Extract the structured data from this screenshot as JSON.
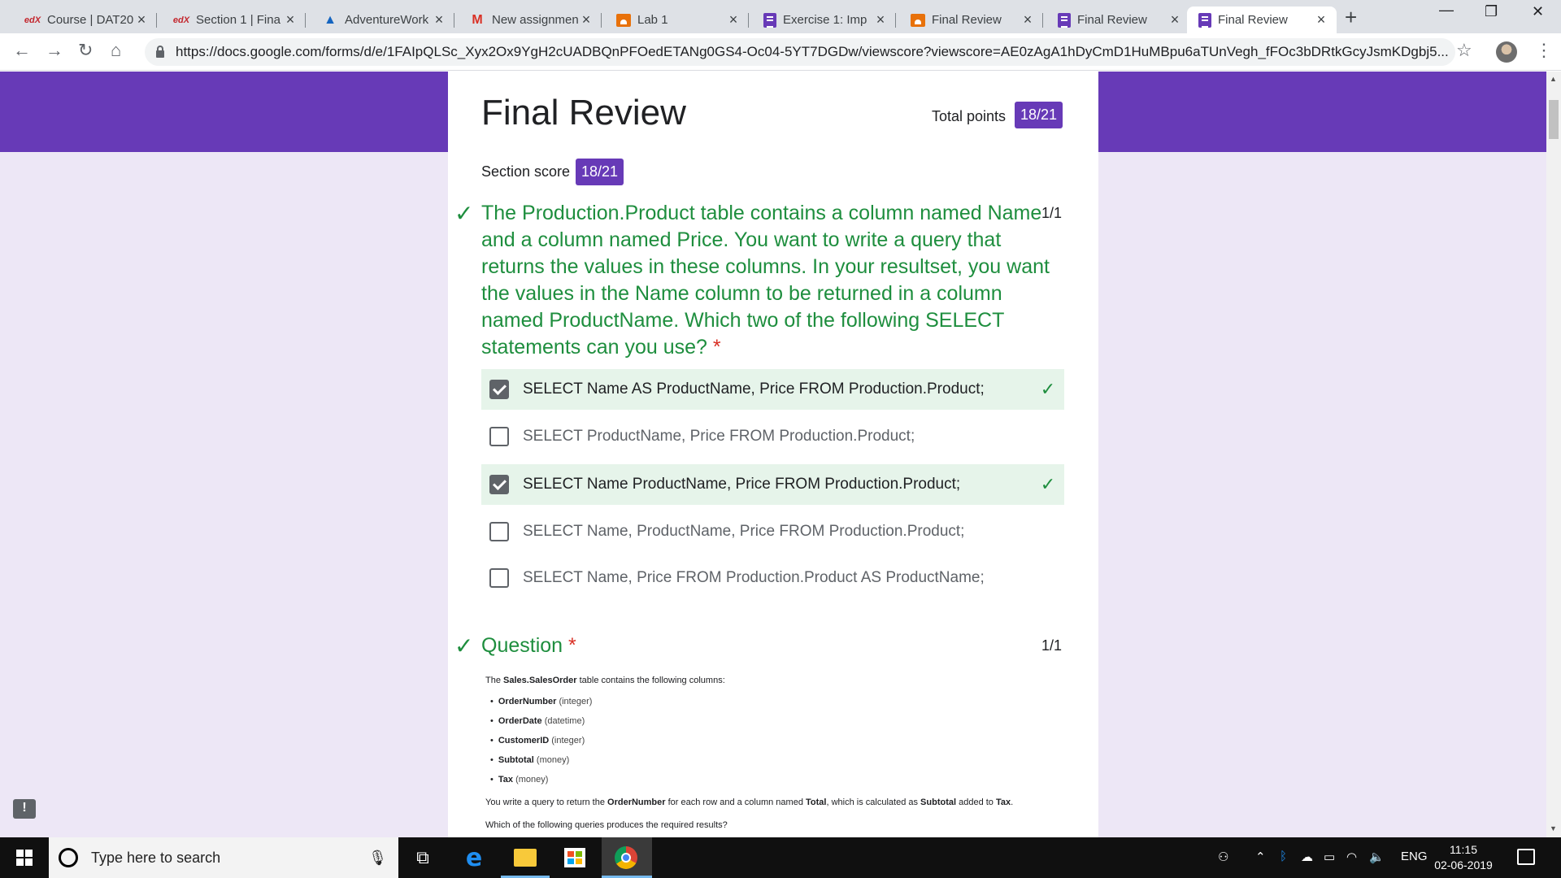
{
  "browser": {
    "tabs": [
      {
        "favicon": "edx-icon",
        "title": "Course | DAT20",
        "active": false
      },
      {
        "favicon": "edx-icon",
        "title": "Section 1 | Fina",
        "active": false
      },
      {
        "favicon": "azure-icon",
        "title": "AdventureWork",
        "active": false
      },
      {
        "favicon": "gmail-icon",
        "title": "New assignmen",
        "active": false
      },
      {
        "favicon": "classroom-icon",
        "title": "Lab 1",
        "active": false
      },
      {
        "favicon": "forms-icon",
        "title": "Exercise 1: Imp",
        "active": false
      },
      {
        "favicon": "classroom-icon",
        "title": "Final Review",
        "active": false
      },
      {
        "favicon": "forms-icon",
        "title": "Final Review",
        "active": false
      },
      {
        "favicon": "forms-icon",
        "title": "Final Review",
        "active": true
      }
    ],
    "url": "https://docs.google.com/forms/d/e/1FAIpQLSc_Xyx2Ox9YgH2cUADBQnPFOedETANg0GS4-Oc04-5YT7DGDw/viewscore?viewscore=AE0zAgA1hDyCmD1HuMBpu6aTUnVegh_fFOc3bDRtkGcyJsmKDgbj5..."
  },
  "form": {
    "title": "Final Review",
    "total_points_label": "Total points",
    "total_points": "18/21",
    "section_score_label": "Section score",
    "section_score": "18/21",
    "required_mark": "*",
    "q1": {
      "text": "The Production.Product table contains a column named Name and a column named Price. You want to write a query that returns the values in these columns. In your resultset, you want the values in the Name column to be returned in a column named ProductName. Which two of the following SELECT statements can you use?",
      "points": "1/1",
      "options": [
        {
          "label": "SELECT Name AS ProductName, Price FROM Production.Product;",
          "checked": true,
          "correct": true
        },
        {
          "label": "SELECT ProductName, Price FROM Production.Product;",
          "checked": false,
          "correct": false
        },
        {
          "label": "SELECT Name ProductName, Price FROM Production.Product;",
          "checked": true,
          "correct": true
        },
        {
          "label": "SELECT Name, ProductName, Price FROM Production.Product;",
          "checked": false,
          "correct": false
        },
        {
          "label": "SELECT Name, Price FROM Production.Product AS ProductName;",
          "checked": false,
          "correct": false
        }
      ]
    },
    "q2": {
      "title": "Question",
      "points": "1/1",
      "intro_pre": "The ",
      "intro_table": "Sales.SalesOrder",
      "intro_post": " table contains the following columns:",
      "columns": [
        {
          "name": "OrderNumber",
          "type": "(integer)"
        },
        {
          "name": "OrderDate",
          "type": "(datetime)"
        },
        {
          "name": "CustomerID",
          "type": "(integer)"
        },
        {
          "name": "Subtotal",
          "type": "(money)"
        },
        {
          "name": "Tax",
          "type": "(money)"
        }
      ],
      "para_1": "You write a query to return the",
      "para_2": "OrderNumber",
      "para_3": "for each row and a column named",
      "para_4": "Total",
      "para_5": ", which is calculated as",
      "para_6": "Subtotal",
      "para_7": "added to",
      "para_8": "Tax",
      "para_9": ".",
      "question_line": "Which of the following queries produces the required results?"
    }
  },
  "taskbar": {
    "search_placeholder": "Type here to search",
    "language": "ENG",
    "time": "11:15",
    "date": "02-06-2019"
  },
  "colors": {
    "accent": "#673ab7",
    "correct": "#1e8e3e",
    "correct_bg": "#e6f4ea",
    "page_bg": "#ede7f6"
  }
}
